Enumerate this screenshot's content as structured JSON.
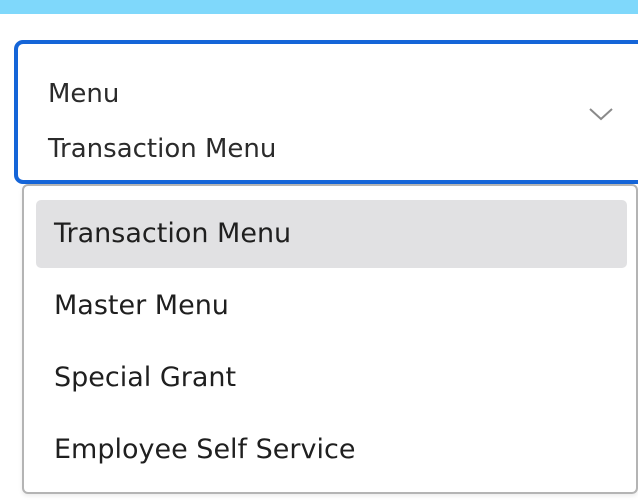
{
  "select": {
    "label": "Menu",
    "value": "Transaction Menu",
    "chevron_icon": "chevron-down-icon",
    "accent_color": "#1565d8"
  },
  "dropdown": {
    "items": [
      {
        "label": "Transaction Menu",
        "selected": true
      },
      {
        "label": "Master Menu",
        "selected": false
      },
      {
        "label": "Special Grant",
        "selected": false
      },
      {
        "label": "Employee Self Service",
        "selected": false
      }
    ],
    "highlight_color": "#e1e1e3"
  },
  "colors": {
    "background": "#7fd8fb",
    "panel": "#ffffff"
  }
}
